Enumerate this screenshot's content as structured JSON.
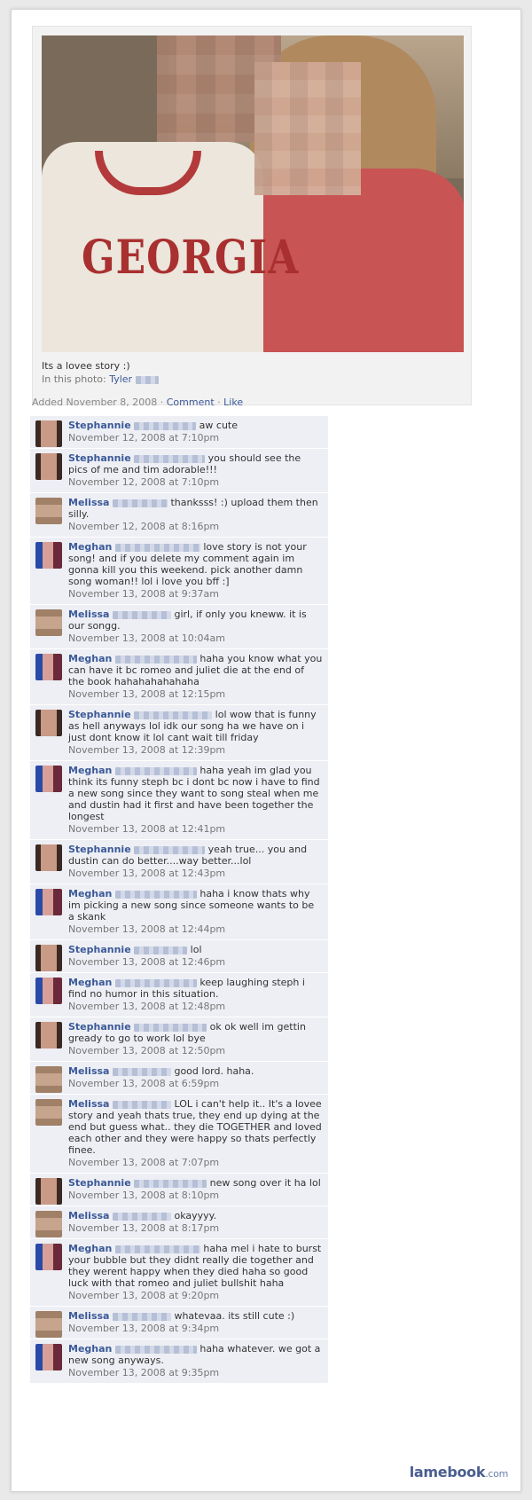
{
  "photo": {
    "shirt_text": "GEORGIA",
    "caption": "Its a lovee story :)",
    "in_photo_label": "In this photo:",
    "in_photo_name": "Tyler"
  },
  "meta": {
    "added": "Added November 8, 2008",
    "comment_link": "Comment",
    "like_link": "Like"
  },
  "comments": [
    {
      "avatar": "stephannie",
      "name": "Stephannie",
      "text": "aw cute",
      "time": "November 12, 2008 at 7:10pm"
    },
    {
      "avatar": "stephannie",
      "name": "Stephannie",
      "text": "you should see the pics of me and tim adorable!!!",
      "time": "November 12, 2008 at 7:10pm"
    },
    {
      "avatar": "melissa",
      "name": "Melissa",
      "text": "thanksss! :) upload them then silly.",
      "time": "November 12, 2008 at 8:16pm"
    },
    {
      "avatar": "meghan",
      "name": "Meghan",
      "text": "love story is not your song! and if you delete my comment again im gonna kill you this weekend. pick another damn song woman!! lol i love you bff :]",
      "time": "November 13, 2008 at 9:37am"
    },
    {
      "avatar": "melissa",
      "name": "Melissa",
      "text": "girl, if only you kneww. it is our songg.",
      "time": "November 13, 2008 at 10:04am"
    },
    {
      "avatar": "meghan",
      "name": "Meghan",
      "text": "haha you know what you can have it bc romeo and juliet die at the end of the book hahahahahahaha",
      "time": "November 13, 2008 at 12:15pm"
    },
    {
      "avatar": "stephannie",
      "name": "Stephannie",
      "text": "lol wow that is funny as hell anyways lol idk our song ha we have on i just dont know it lol cant wait till friday",
      "time": "November 13, 2008 at 12:39pm"
    },
    {
      "avatar": "meghan",
      "name": "Meghan",
      "text": "haha yeah im glad you think its funny steph bc i dont bc now i have to find a new song since they want to song steal when me and dustin had it first and have been together the longest",
      "time": "November 13, 2008 at 12:41pm"
    },
    {
      "avatar": "stephannie",
      "name": "Stephannie",
      "text": "yeah true... you and dustin can do better....way better...lol",
      "time": "November 13, 2008 at 12:43pm"
    },
    {
      "avatar": "meghan",
      "name": "Meghan",
      "text": "haha i know thats why im picking a new song since someone wants to be a skank",
      "time": "November 13, 2008 at 12:44pm"
    },
    {
      "avatar": "stephannie",
      "name": "Stephannie",
      "text": "lol",
      "time": "November 13, 2008 at 12:46pm"
    },
    {
      "avatar": "meghan",
      "name": "Meghan",
      "text": "keep laughing steph i find no humor in this situation.",
      "time": "November 13, 2008 at 12:48pm"
    },
    {
      "avatar": "stephannie",
      "name": "Stephannie",
      "text": "ok ok well im gettin gready to go to work lol bye",
      "time": "November 13, 2008 at 12:50pm"
    },
    {
      "avatar": "melissa",
      "name": "Melissa",
      "text": "good lord. haha.",
      "time": "November 13, 2008 at 6:59pm"
    },
    {
      "avatar": "melissa",
      "name": "Melissa",
      "text": "LOL i can't help it.. It's a lovee story and yeah thats true, they end up dying at the end but guess what.. they die TOGETHER and loved each other and they were happy so thats perfectly finee.",
      "time": "November 13, 2008 at 7:07pm"
    },
    {
      "avatar": "stephannie",
      "name": "Stephannie",
      "text": "new song over it ha lol",
      "time": "November 13, 2008 at 8:10pm"
    },
    {
      "avatar": "melissa",
      "name": "Melissa",
      "text": "okayyyy.",
      "time": "November 13, 2008 at 8:17pm"
    },
    {
      "avatar": "meghan",
      "name": "Meghan",
      "text": "haha mel i hate to burst your bubble but they didnt really die together and they werent happy when they died haha so good luck with that romeo and juliet bullshit haha",
      "time": "November 13, 2008 at 9:20pm"
    },
    {
      "avatar": "melissa",
      "name": "Melissa",
      "text": "whatevaa. its still cute :)",
      "time": "November 13, 2008 at 9:34pm"
    },
    {
      "avatar": "meghan",
      "name": "Meghan",
      "text": "haha whatever. we got a new song anyways.",
      "time": "November 13, 2008 at 9:35pm"
    }
  ],
  "branding": {
    "name": "lamebook",
    "suffix": ".com"
  }
}
